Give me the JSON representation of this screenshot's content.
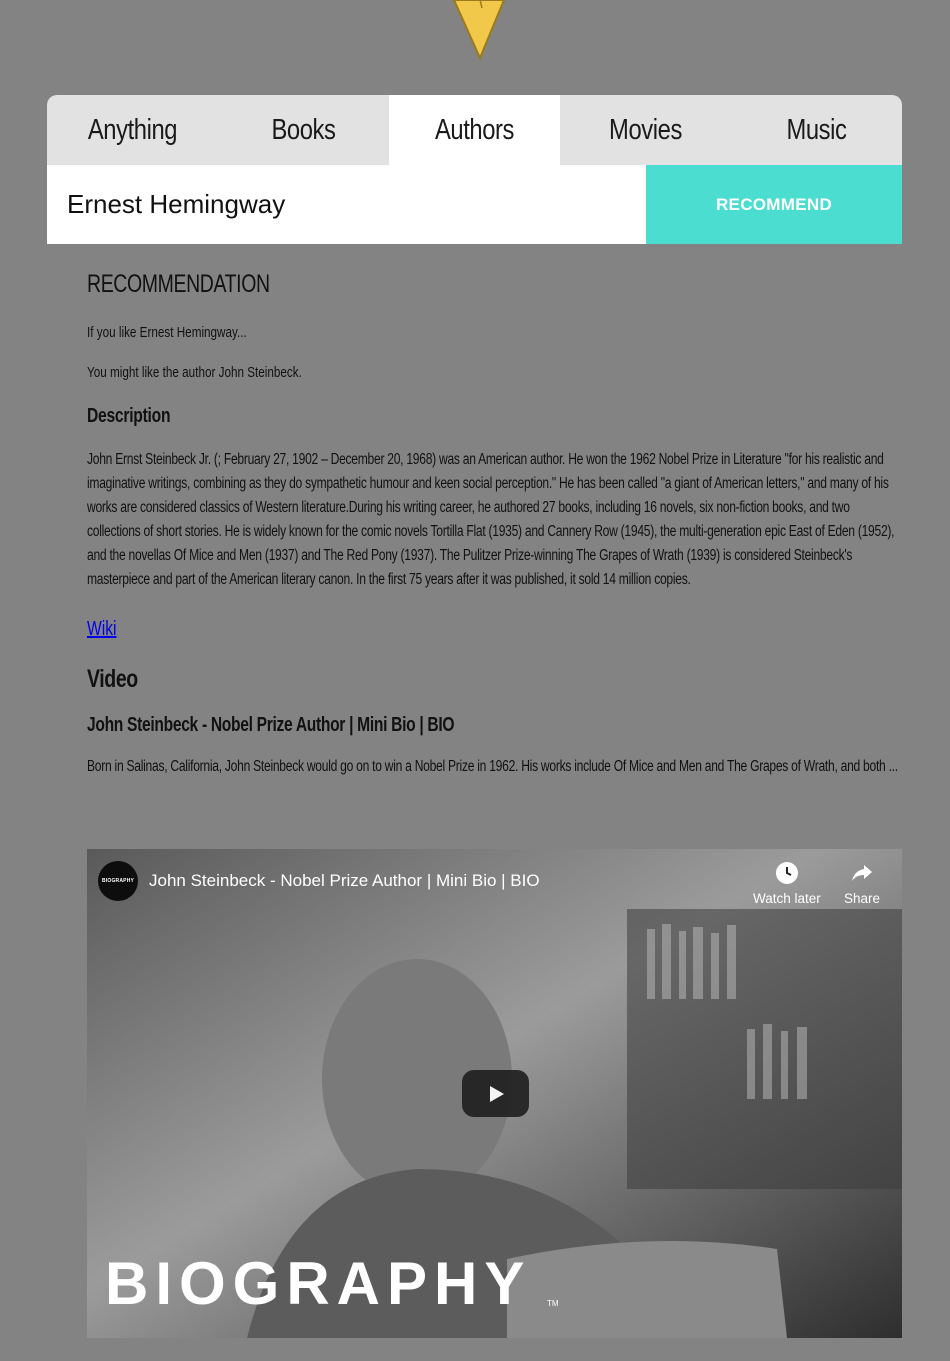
{
  "tabs": [
    {
      "label": "Anything"
    },
    {
      "label": "Books"
    },
    {
      "label": "Authors"
    },
    {
      "label": "Movies"
    },
    {
      "label": "Music"
    }
  ],
  "active_tab": "Authors",
  "search": {
    "value": "Ernest Hemingway",
    "button_label": "RECOMMEND"
  },
  "recommendation": {
    "heading": "RECOMMENDATION",
    "intro": "If you like Ernest Hemingway...",
    "result": "You might like the author John Steinbeck.",
    "description_heading": "Description",
    "description": "John Ernst Steinbeck Jr. (; February 27, 1902 – December 20, 1968) was an American author. He won the 1962 Nobel Prize in Literature \"for his realistic and imaginative writings, combining as they do sympathetic humour and keen social perception.\" He has been called \"a giant of American letters,\" and many of his works are considered classics of Western literature.During his writing career, he authored 27 books, including 16 novels, six non-fiction books, and two collections of short stories. He is widely known for the comic novels Tortilla Flat (1935) and Cannery Row (1945), the multi-generation epic East of Eden (1952), and the novellas Of Mice and Men (1937) and The Red Pony (1937). The Pulitzer Prize-winning The Grapes of Wrath (1939) is considered Steinbeck's masterpiece and part of the American literary canon. In the first 75 years after it was published, it sold 14 million copies.",
    "wiki_label": "Wiki"
  },
  "video": {
    "heading": "Video",
    "title": "John Steinbeck - Nobel Prize Author | Mini Bio | BIO",
    "description": "Born in Salinas, California, John Steinbeck would go on to win a Nobel Prize in 1962. His works include Of Mice and Men and The Grapes of Wrath, and both ...",
    "player": {
      "channel_logo_text": "BIOGRAPHY",
      "title": "John Steinbeck - Nobel Prize Author | Mini Bio | BIO",
      "watch_later": "Watch later",
      "share": "Share",
      "brand_text": "BIOGRAPHY",
      "brand_tm": "TM"
    }
  },
  "colors": {
    "background": "#838383",
    "accent": "#4bded0",
    "tab_bar": "#e2e2e2",
    "cone": "#f2c84b",
    "link": "#0000ee"
  },
  "icons": [
    "ice-cream-cone-icon",
    "clock-icon",
    "share-arrow-icon",
    "play-icon"
  ]
}
